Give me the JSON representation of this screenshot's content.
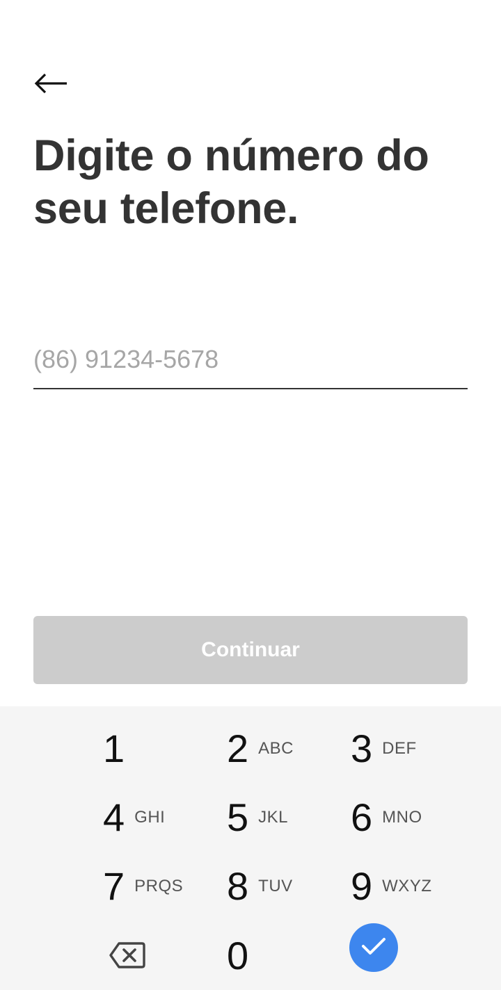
{
  "header": {
    "back_icon": "arrow-left-icon",
    "title": "Digite o número do seu telefone."
  },
  "phone": {
    "value": "",
    "placeholder": "(86) 91234-5678"
  },
  "actions": {
    "continue_label": "Continuar",
    "continue_bg": "#cccccc",
    "continue_enabled": false
  },
  "keypad": {
    "background": "#f5f5f5",
    "keys": [
      {
        "digit": "1",
        "letters": ""
      },
      {
        "digit": "2",
        "letters": "ABC"
      },
      {
        "digit": "3",
        "letters": "DEF"
      },
      {
        "digit": "4",
        "letters": "GHI"
      },
      {
        "digit": "5",
        "letters": "JKL"
      },
      {
        "digit": "6",
        "letters": "MNO"
      },
      {
        "digit": "7",
        "letters": "PRQS"
      },
      {
        "digit": "8",
        "letters": "TUV"
      },
      {
        "digit": "9",
        "letters": "WXYZ"
      },
      {
        "digit": "0",
        "letters": ""
      }
    ],
    "backspace_icon": "backspace-icon",
    "done_icon": "check-icon",
    "done_color": "#3d86ee"
  }
}
